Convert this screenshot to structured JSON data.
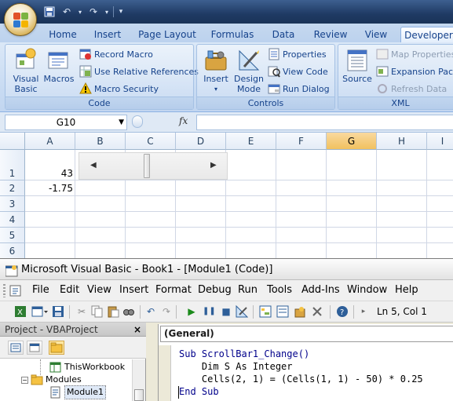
{
  "excel": {
    "tabs": [
      "Home",
      "Insert",
      "Page Layout",
      "Formulas",
      "Data",
      "Review",
      "View",
      "Developer"
    ],
    "active_tab": "Developer",
    "ribbon": {
      "code_group": {
        "label": "Code",
        "visual_basic": "Visual Basic",
        "macros": "Macros",
        "record_macro": "Record Macro",
        "use_relative_references": "Use Relative References",
        "macro_security": "Macro Security"
      },
      "controls_group": {
        "label": "Controls",
        "insert": "Insert",
        "design_mode": "Design Mode",
        "properties": "Properties",
        "view_code": "View Code",
        "run_dialog": "Run Dialog"
      },
      "xml_group": {
        "label": "XML",
        "source": "Source",
        "map_properties": "Map Properties",
        "expansion_packs": "Expansion Packs",
        "refresh_data": "Refresh Data"
      }
    },
    "name_box": "G10",
    "fx_label": "fx",
    "formula": "",
    "columns": [
      "A",
      "B",
      "C",
      "D",
      "E",
      "F",
      "G",
      "H",
      "I"
    ],
    "selected_column": "G",
    "rows": [
      "1",
      "2",
      "3",
      "4",
      "5",
      "6"
    ],
    "cells": {
      "A1": "43",
      "A2": "-1.75"
    },
    "scrollbar": {
      "value": 43,
      "min": 0,
      "max": 100
    }
  },
  "vbe": {
    "title": "Microsoft Visual Basic - Book1 - [Module1 (Code)]",
    "menu": [
      "File",
      "Edit",
      "View",
      "Insert",
      "Format",
      "Debug",
      "Run",
      "Tools",
      "Add-Ins",
      "Window",
      "Help"
    ],
    "cursor_position": "Ln 5, Col 1",
    "project_pane": {
      "title": "Project - VBAProject",
      "close": "×",
      "tree": [
        {
          "label": "ThisWorkbook",
          "level": 2
        },
        {
          "label": "Modules",
          "level": 1
        },
        {
          "label": "Module1",
          "level": 2,
          "selected": true
        }
      ]
    },
    "code_pane": {
      "object_dropdown": "(General)",
      "lines": [
        "Sub ScrollBar1_Change()",
        "    Dim S As Integer",
        "    Cells(2, 1) = (Cells(1, 1) - 50) * 0.25",
        "End Sub"
      ]
    }
  },
  "colors": {
    "ribbon_text": "#15428b",
    "selected_column": "#f1c15f",
    "vba_keyword": "#00008b"
  }
}
